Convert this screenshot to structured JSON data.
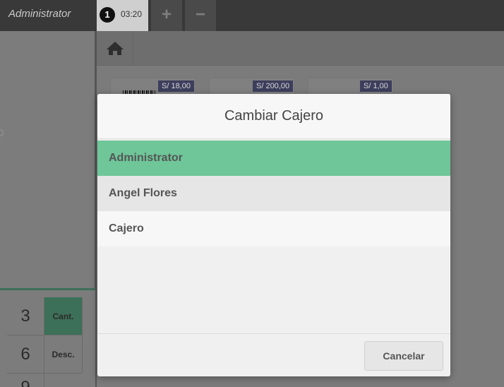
{
  "topbar": {
    "user_name": "Administrator",
    "order_tab": {
      "number": "1",
      "time": "03:20"
    },
    "add_label": "+",
    "remove_label": "−"
  },
  "numpad": {
    "keys": [
      "3",
      "Cant.",
      "6",
      "Desc.",
      "9"
    ]
  },
  "products": {
    "prices": [
      "S/ 18,00",
      "S/ 200,00",
      "S/ 1,00"
    ]
  },
  "modal": {
    "title": "Cambiar Cajero",
    "cashiers": [
      "Administrator",
      "Angel Flores",
      "Cajero"
    ],
    "selected_index": 0,
    "cancel_label": "Cancelar"
  },
  "colors": {
    "selected": "#6ec699",
    "topbar": "#393939",
    "price_tag": "#3d3e5c"
  },
  "icons": [
    "home-icon"
  ]
}
